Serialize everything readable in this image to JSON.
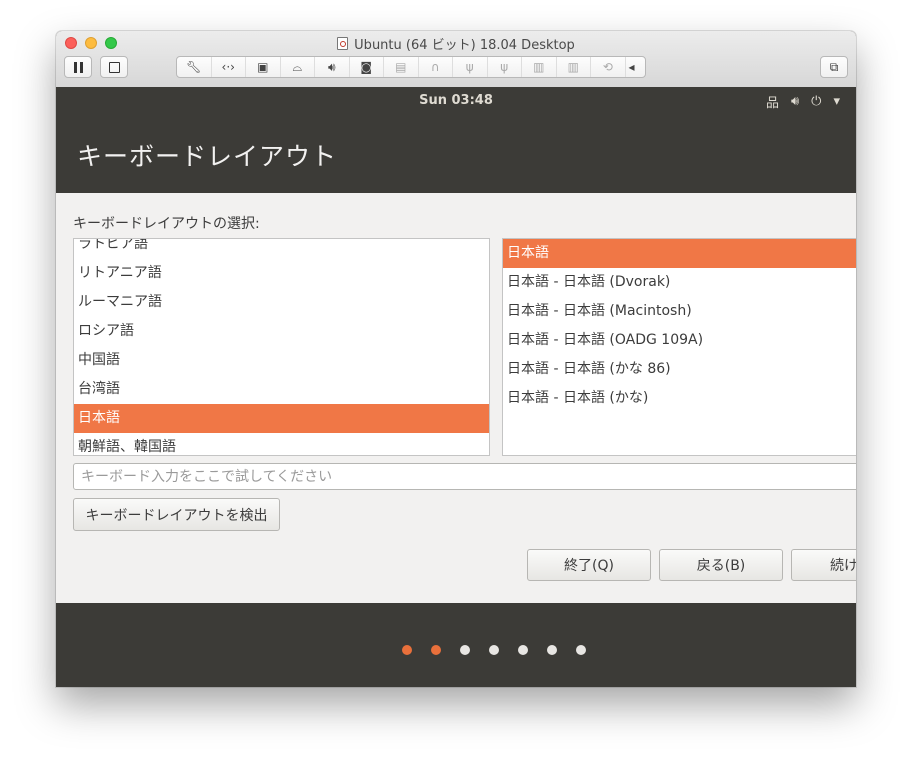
{
  "window": {
    "title": "Ubuntu (64 ビット) 18.04 Desktop",
    "accent_color": "#f07746",
    "panel_color": "#3c3b37"
  },
  "toolbar": {
    "pause_icon": "pause-icon",
    "snapshot_icon": "snapshot-icon",
    "icons": [
      "wrench-icon",
      "code-icon",
      "disk-icon",
      "hard-drive-icon",
      "speaker-icon",
      "camera-icon",
      "printer-icon",
      "headphones-icon",
      "usb-icon",
      "usb-icon",
      "device-icon",
      "device-icon",
      "refresh-icon",
      "chevron-left-icon"
    ],
    "window_icon": "window-copy-icon"
  },
  "top_panel": {
    "clock": "Sun 03:48",
    "tray": [
      "network-icon",
      "volume-icon",
      "power-icon",
      "caret-down-icon"
    ]
  },
  "page": {
    "title": "キーボードレイアウト",
    "section_label": "キーボードレイアウトの選択:"
  },
  "layouts": [
    {
      "label": "ラトビア語",
      "selected": false
    },
    {
      "label": "リトアニア語",
      "selected": false
    },
    {
      "label": "ルーマニア語",
      "selected": false
    },
    {
      "label": "ロシア語",
      "selected": false
    },
    {
      "label": "中国語",
      "selected": false
    },
    {
      "label": "台湾語",
      "selected": false
    },
    {
      "label": "日本語",
      "selected": true
    },
    {
      "label": "朝鮮語、韓国語",
      "selected": false
    }
  ],
  "variants": [
    {
      "label": "日本語",
      "selected": true
    },
    {
      "label": "日本語 - 日本語 (Dvorak)",
      "selected": false
    },
    {
      "label": "日本語 - 日本語 (Macintosh)",
      "selected": false
    },
    {
      "label": "日本語 - 日本語 (OADG 109A)",
      "selected": false
    },
    {
      "label": "日本語 - 日本語 (かな 86)",
      "selected": false
    },
    {
      "label": "日本語 - 日本語 (かな)",
      "selected": false
    }
  ],
  "test_input": {
    "placeholder": "キーボード入力をここで試してください",
    "value": ""
  },
  "buttons": {
    "detect": "キーボードレイアウトを検出",
    "quit": "終了(Q)",
    "back": "戻る(B)",
    "continue": "続け"
  },
  "progress": {
    "total_steps": 7,
    "completed_steps": 2
  }
}
